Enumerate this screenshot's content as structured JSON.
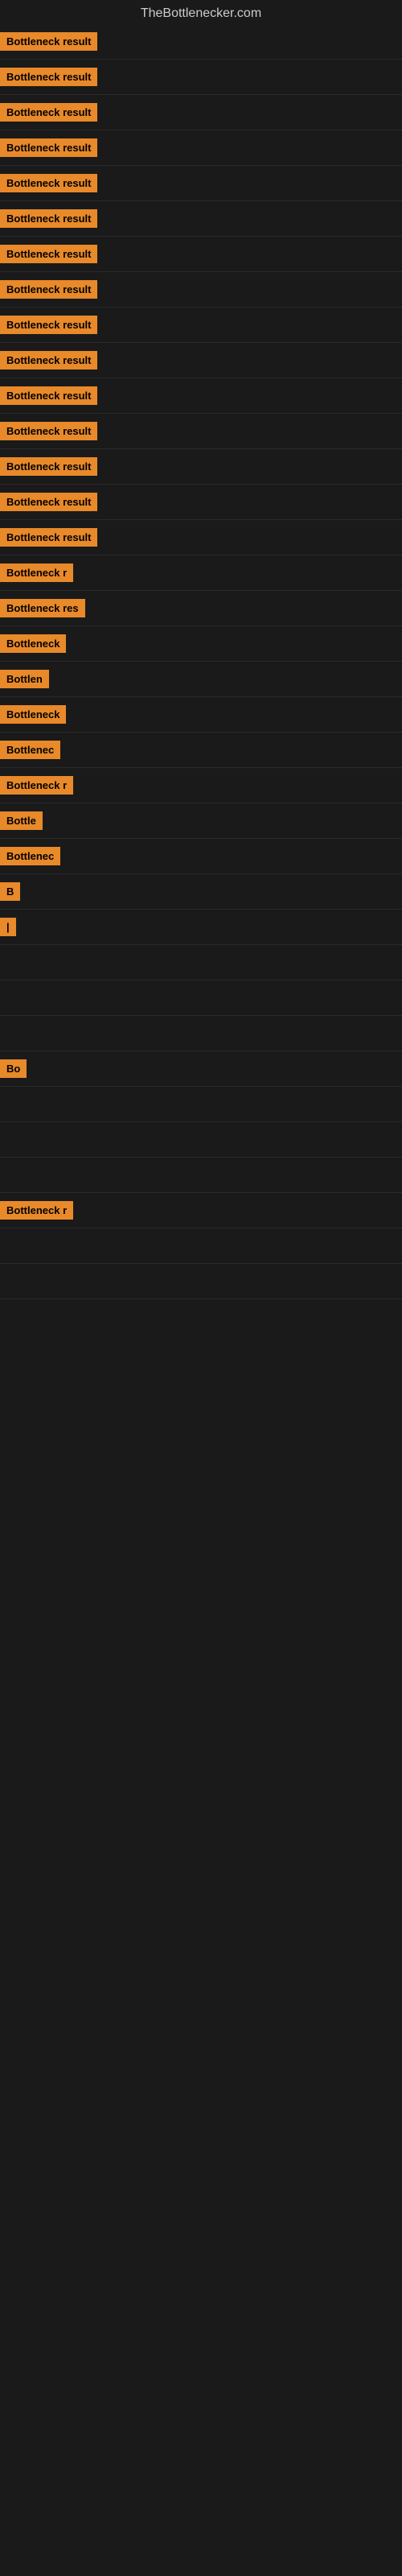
{
  "site": {
    "title": "TheBottlenecker.com"
  },
  "items": [
    {
      "label": "Bottleneck result",
      "label_width": 130,
      "bar_width": 0
    },
    {
      "label": "Bottleneck result",
      "label_width": 130,
      "bar_width": 0
    },
    {
      "label": "Bottleneck result",
      "label_width": 130,
      "bar_width": 0
    },
    {
      "label": "Bottleneck result",
      "label_width": 130,
      "bar_width": 0
    },
    {
      "label": "Bottleneck result",
      "label_width": 130,
      "bar_width": 0
    },
    {
      "label": "Bottleneck result",
      "label_width": 130,
      "bar_width": 0
    },
    {
      "label": "Bottleneck result",
      "label_width": 130,
      "bar_width": 0
    },
    {
      "label": "Bottleneck result",
      "label_width": 130,
      "bar_width": 0
    },
    {
      "label": "Bottleneck result",
      "label_width": 130,
      "bar_width": 0
    },
    {
      "label": "Bottleneck result",
      "label_width": 130,
      "bar_width": 0
    },
    {
      "label": "Bottleneck result",
      "label_width": 130,
      "bar_width": 0
    },
    {
      "label": "Bottleneck result",
      "label_width": 130,
      "bar_width": 0
    },
    {
      "label": "Bottleneck result",
      "label_width": 130,
      "bar_width": 0
    },
    {
      "label": "Bottleneck result",
      "label_width": 130,
      "bar_width": 0
    },
    {
      "label": "Bottleneck result",
      "label_width": 120,
      "bar_width": 0
    },
    {
      "label": "Bottleneck r",
      "label_width": 95,
      "bar_width": 0
    },
    {
      "label": "Bottleneck res",
      "label_width": 105,
      "bar_width": 0
    },
    {
      "label": "Bottleneck",
      "label_width": 85,
      "bar_width": 0
    },
    {
      "label": "Bottlen",
      "label_width": 65,
      "bar_width": 0
    },
    {
      "label": "Bottleneck",
      "label_width": 85,
      "bar_width": 0
    },
    {
      "label": "Bottlenec",
      "label_width": 78,
      "bar_width": 0
    },
    {
      "label": "Bottleneck r",
      "label_width": 92,
      "bar_width": 0
    },
    {
      "label": "Bottle",
      "label_width": 58,
      "bar_width": 0
    },
    {
      "label": "Bottlenec",
      "label_width": 78,
      "bar_width": 0
    },
    {
      "label": "B",
      "label_width": 18,
      "bar_width": 0
    },
    {
      "label": "|",
      "label_width": 10,
      "bar_width": 0
    },
    {
      "label": "",
      "label_width": 0,
      "bar_width": 0
    },
    {
      "label": "",
      "label_width": 0,
      "bar_width": 0
    },
    {
      "label": "",
      "label_width": 0,
      "bar_width": 0
    },
    {
      "label": "Bo",
      "label_width": 24,
      "bar_width": 0
    },
    {
      "label": "",
      "label_width": 0,
      "bar_width": 0
    },
    {
      "label": "",
      "label_width": 0,
      "bar_width": 0
    },
    {
      "label": "",
      "label_width": 0,
      "bar_width": 0
    },
    {
      "label": "Bottleneck r",
      "label_width": 95,
      "bar_width": 0
    },
    {
      "label": "",
      "label_width": 0,
      "bar_width": 0
    },
    {
      "label": "",
      "label_width": 0,
      "bar_width": 0
    }
  ]
}
